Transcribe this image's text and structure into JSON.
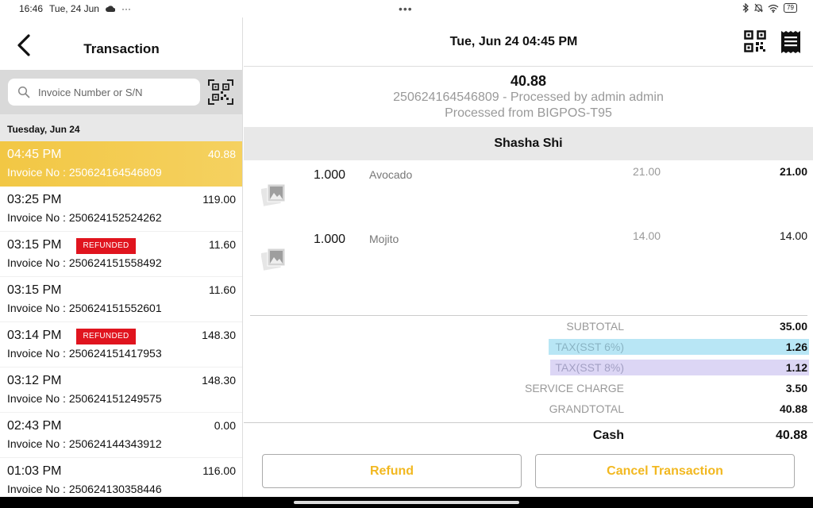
{
  "status_bar": {
    "time": "16:46",
    "date": "Tue, 24 Jun",
    "more": "···",
    "center_dots": "•••",
    "battery": "79",
    "icons": [
      "cloud-icon",
      "bluetooth-icon",
      "mute-icon",
      "wifi-icon",
      "battery-icon"
    ]
  },
  "sidebar": {
    "title": "Transaction",
    "search_placeholder": "Invoice Number or S/N",
    "date_header": "Tuesday, Jun 24",
    "refund_badge": "REFUNDED",
    "transactions": [
      {
        "time": "04:45 PM",
        "invoice": "Invoice No : 250624164546809",
        "amount": "40.88",
        "selected": true,
        "refunded": false
      },
      {
        "time": "03:25 PM",
        "invoice": "Invoice No : 250624152524262",
        "amount": "119.00",
        "selected": false,
        "refunded": false
      },
      {
        "time": "03:15 PM",
        "invoice": "Invoice No : 250624151558492",
        "amount": "11.60",
        "selected": false,
        "refunded": true
      },
      {
        "time": "03:15 PM",
        "invoice": "Invoice No : 250624151552601",
        "amount": "11.60",
        "selected": false,
        "refunded": false
      },
      {
        "time": "03:14 PM",
        "invoice": "Invoice No : 250624151417953",
        "amount": "148.30",
        "selected": false,
        "refunded": true
      },
      {
        "time": "03:12 PM",
        "invoice": "Invoice No : 250624151249575",
        "amount": "148.30",
        "selected": false,
        "refunded": false
      },
      {
        "time": "02:43 PM",
        "invoice": "Invoice No : 250624144343912",
        "amount": "0.00",
        "selected": false,
        "refunded": false
      },
      {
        "time": "01:03 PM",
        "invoice": "Invoice No : 250624130358446",
        "amount": "116.00",
        "selected": false,
        "refunded": false
      }
    ]
  },
  "detail": {
    "datetime": "Tue, Jun 24 04:45 PM",
    "total": "40.88",
    "processed_by": "250624164546809 - Processed by admin admin",
    "processed_from": "Processed from BIGPOS-T95",
    "customer": "Shasha Shi",
    "items": [
      {
        "qty": "1.000",
        "name": "Avocado",
        "price": "21.00",
        "total": "21.00"
      },
      {
        "qty": "1.000",
        "name": "Mojito",
        "price": "14.00",
        "total": "14.00"
      }
    ],
    "totals": {
      "subtotal_label": "SUBTOTAL",
      "subtotal": "35.00",
      "tax6_label": "TAX(SST 6%)",
      "tax6": "1.26",
      "tax8_label": "TAX(SST 8%)",
      "tax8": "1.12",
      "service_label": "SERVICE CHARGE",
      "service": "3.50",
      "grand_label": "GRANDTOTAL",
      "grand": "40.88"
    },
    "payment": {
      "method": "Cash",
      "amount": "40.88"
    },
    "refund_button": "Refund",
    "cancel_button": "Cancel Transaction"
  },
  "colors": {
    "accent": "#f2c744",
    "button_text": "#f2b820",
    "refunded": "#e0141e",
    "tax6_highlight": "#b8e6f5",
    "tax8_highlight": "#dcd6f5"
  }
}
